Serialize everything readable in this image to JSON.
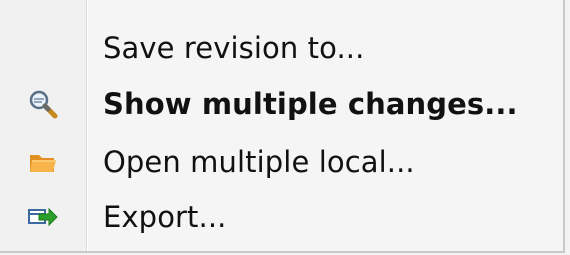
{
  "menu": {
    "items": [
      {
        "label": "Save revision to...",
        "icon": "none",
        "bold": false
      },
      {
        "label": "Show multiple changes...",
        "icon": "magnifier-icon",
        "bold": true
      },
      {
        "label": "Open multiple local...",
        "icon": "folder-icon",
        "bold": false
      },
      {
        "label": "Export...",
        "icon": "export-icon",
        "bold": false
      }
    ]
  },
  "colors": {
    "background": "#f5f5f5",
    "text": "#111111",
    "separator": "#d9d9d9",
    "folder": "#f0a43a",
    "export_green": "#2aa02a"
  }
}
